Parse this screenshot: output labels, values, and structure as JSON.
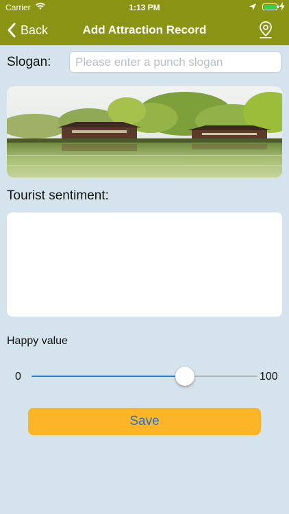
{
  "status_bar": {
    "carrier": "Carrier",
    "time": "1:13 PM",
    "icons": [
      "wifi-icon",
      "location-arrow-icon",
      "battery-icon",
      "charging-bolt-icon"
    ]
  },
  "nav": {
    "back_label": "Back",
    "title": "Add Attraction Record",
    "right_icon": "map-pin-icon",
    "color": "#8a9412"
  },
  "form": {
    "slogan_label": "Slogan:",
    "slogan_placeholder": "Please enter a punch slogan",
    "slogan_value": "",
    "sentiment_label": "Tourist sentiment:",
    "sentiment_value": "",
    "happy_label": "Happy value",
    "happy_min": "0",
    "happy_max": "100",
    "happy_value": 0.68
  },
  "save_button": {
    "label": "Save",
    "color": "#fbb526",
    "text_color": "#2a6fd0"
  },
  "colors": {
    "background": "#d5e4ec",
    "slider_active": "#1c7fe6"
  }
}
